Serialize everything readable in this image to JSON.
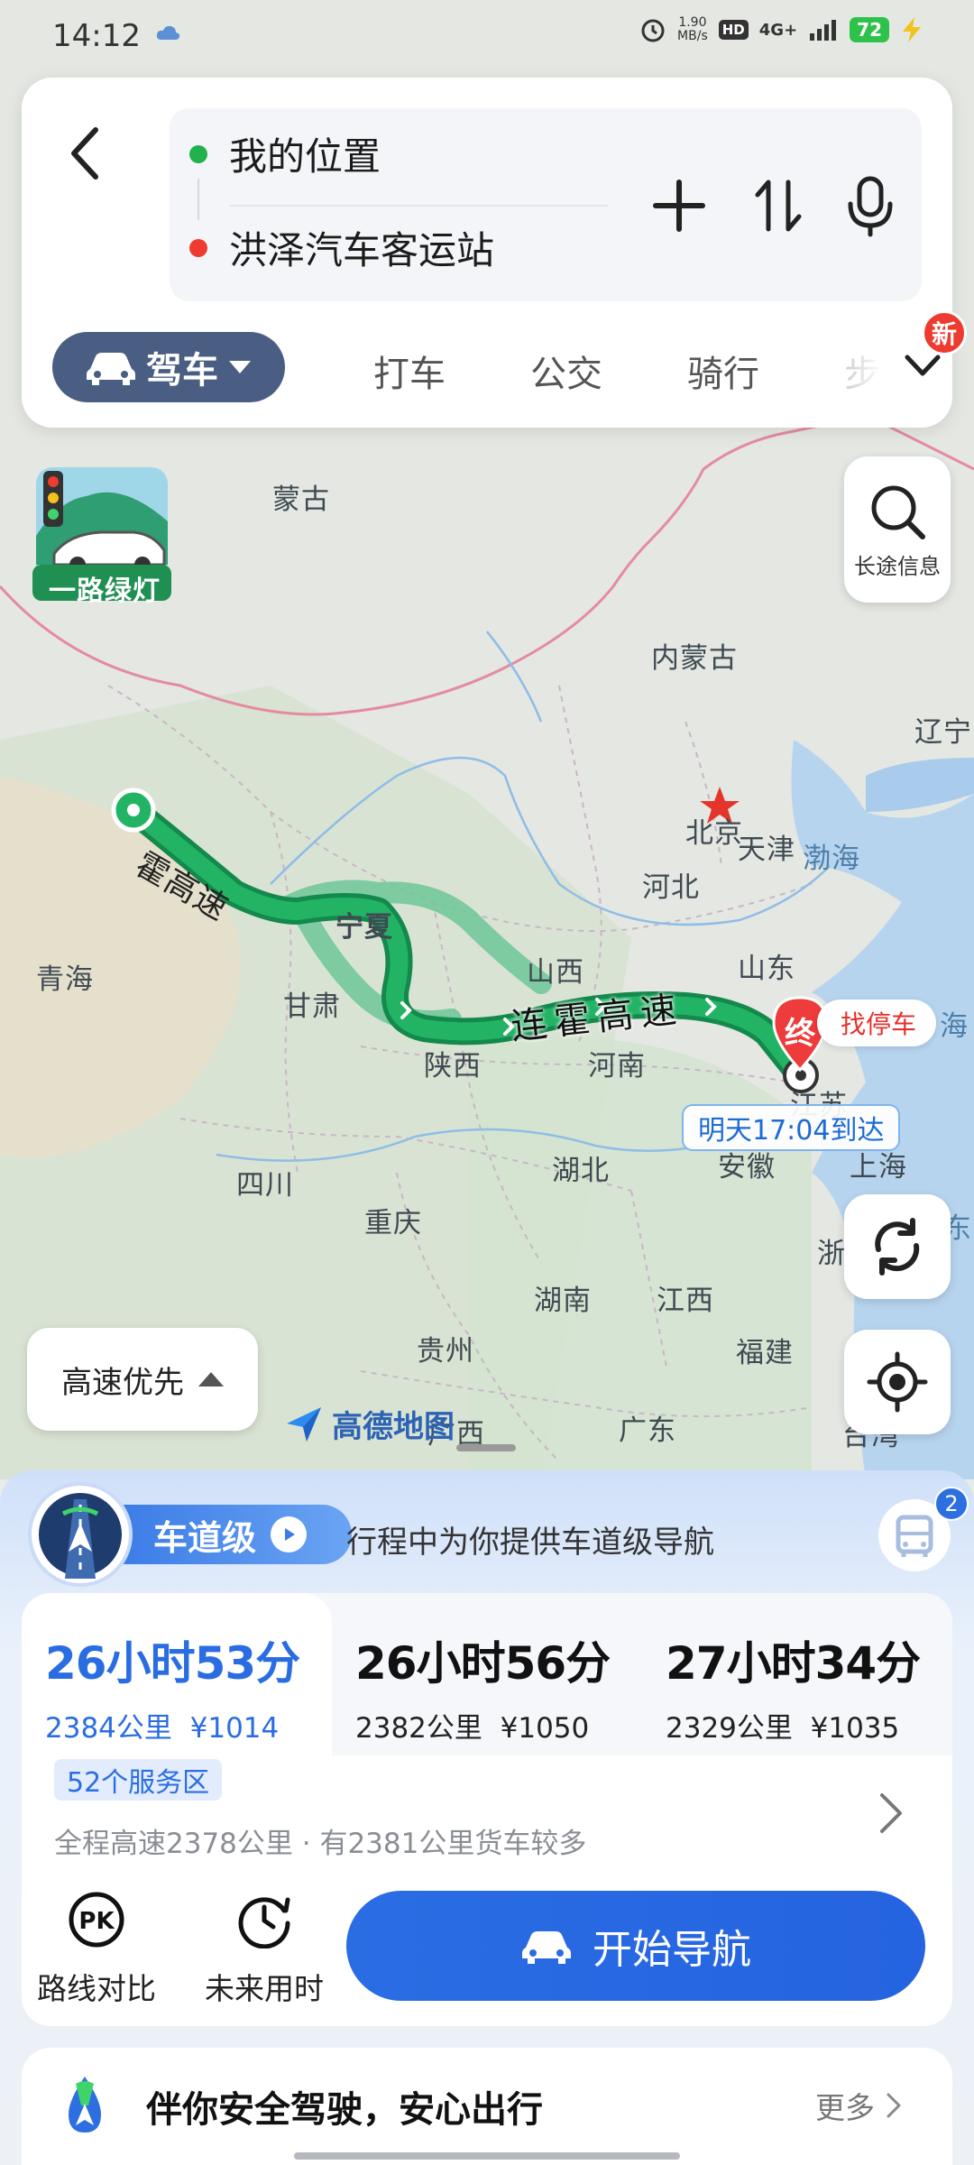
{
  "status_bar": {
    "time": "14:12",
    "net_speed_value": "1.90",
    "net_speed_unit": "MB/s",
    "hd": "HD",
    "signal": "4G+",
    "battery": "72"
  },
  "search": {
    "origin": "我的位置",
    "destination": "洪泽汽车客运站"
  },
  "modes": {
    "active": "驾车",
    "tabs": [
      "打车",
      "公交",
      "骑行",
      "步"
    ],
    "new_badge": "新"
  },
  "map": {
    "green_light_label": "一路绿灯",
    "long_trip_label": "长途信息",
    "regions": [
      {
        "name": "蒙古",
        "kind": "region"
      },
      {
        "name": "内蒙古",
        "kind": "region"
      },
      {
        "name": "辽宁",
        "kind": "region"
      },
      {
        "name": "北京",
        "kind": "region"
      },
      {
        "name": "天津",
        "kind": "region"
      },
      {
        "name": "渤海",
        "kind": "sea"
      },
      {
        "name": "河北",
        "kind": "region"
      },
      {
        "name": "宁夏",
        "kind": "region"
      },
      {
        "name": "山西",
        "kind": "region"
      },
      {
        "name": "山东",
        "kind": "region"
      },
      {
        "name": "青海",
        "kind": "region"
      },
      {
        "name": "甘肃",
        "kind": "region"
      },
      {
        "name": "陕西",
        "kind": "region"
      },
      {
        "name": "河南",
        "kind": "region"
      },
      {
        "name": "海",
        "kind": "sea"
      },
      {
        "name": "江苏",
        "kind": "region"
      },
      {
        "name": "安徽",
        "kind": "region"
      },
      {
        "name": "上海",
        "kind": "region"
      },
      {
        "name": "湖北",
        "kind": "region"
      },
      {
        "name": "四川",
        "kind": "region"
      },
      {
        "name": "重庆",
        "kind": "region"
      },
      {
        "name": "浙",
        "kind": "region"
      },
      {
        "name": "东",
        "kind": "sea"
      },
      {
        "name": "湖南",
        "kind": "region"
      },
      {
        "name": "江西",
        "kind": "region"
      },
      {
        "name": "贵州",
        "kind": "region"
      },
      {
        "name": "福建",
        "kind": "region"
      },
      {
        "name": "广东",
        "kind": "region"
      },
      {
        "name": "广西",
        "kind": "region"
      },
      {
        "name": "台湾",
        "kind": "region"
      }
    ],
    "highway_label_1": "霍高速",
    "highway_label_2": "连霍高速",
    "end_marker": "终",
    "parking_label": "找停车",
    "arrival": "明天17:04到达",
    "road_pref": "高速优先",
    "brand": "高德地图"
  },
  "lane_nav": {
    "title": "车道级",
    "desc": "行程中为你提供车道级导航",
    "badge": "2"
  },
  "routes": [
    {
      "duration": "26小时53分",
      "distance": "2384公里",
      "cost": "¥1014"
    },
    {
      "duration": "26小时56分",
      "distance": "2382公里",
      "cost": "¥1050"
    },
    {
      "duration": "27小时34分",
      "distance": "2329公里",
      "cost": "¥1035"
    }
  ],
  "route_info": {
    "service_areas": "52个服务区",
    "detail": "全程高速2378公里 · 有2381公里货车较多"
  },
  "actions": {
    "compare": "路线对比",
    "future": "未来用时",
    "start": "开始导航"
  },
  "safety": {
    "text": "伴你安全驾驶，安心出行",
    "more": "更多"
  },
  "colors": {
    "route_green": "#1faa5e",
    "alt_route": "#6fc79a",
    "accent_blue": "#2a6de3",
    "drive_tab": "#4a5d82",
    "danger_red": "#ee3b2f"
  }
}
